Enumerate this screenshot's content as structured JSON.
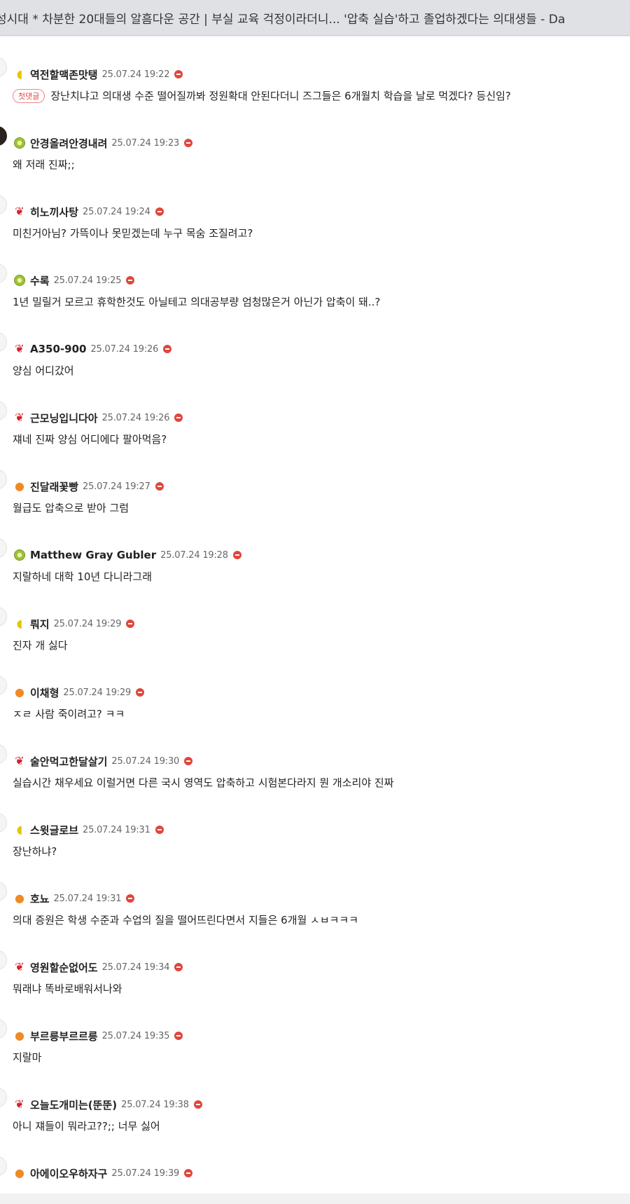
{
  "window": {
    "title": "성시대 *  차분한 20대들의 알흠다운 공간 | 부실 교육 걱정이라더니... '압축 실습'하고 졸업하겠다는 의대생들 - Da"
  },
  "colors": {
    "report": "#e0463c",
    "first_comment_badge": "#e04545",
    "page_background": "#ffffff"
  },
  "comments": [
    {
      "level_icon": "lemon-icon",
      "nickname": "역전할맥존맛탱",
      "timestamp": "25.07.24 19:22",
      "first_badge": "첫댓글",
      "text": "장난치냐고 의대생 수준 떨어질까봐 정원확대 안된다더니 즈그들은 6개월치 학습을 날로 먹겠다? 등신임?"
    },
    {
      "level_icon": "kiwi-icon",
      "nickname": "안경올려안경내려",
      "timestamp": "25.07.24 19:23",
      "text": "왜 저래 진짜;;"
    },
    {
      "level_icon": "cherry-icon",
      "nickname": "히노끼사탕",
      "timestamp": "25.07.24 19:24",
      "text": "미친거아님? 가뜩이나 못믿겠는데 누구 목숨 조질려고?"
    },
    {
      "level_icon": "kiwi-icon",
      "nickname": "수록",
      "timestamp": "25.07.24 19:25",
      "text": "1년 밀릴거 모르고 휴학한것도 아닐테고 의대공부량 엄청많은거 아닌가 압축이 돼..?"
    },
    {
      "level_icon": "cherry-icon",
      "nickname": "A350-900",
      "timestamp": "25.07.24 19:26",
      "text": "양심 어디갔어"
    },
    {
      "level_icon": "cherry-icon",
      "nickname": "근모닝입니다아",
      "timestamp": "25.07.24 19:26",
      "text": "쟤네 진짜 양심 어디에다 팔아먹음?"
    },
    {
      "level_icon": "orange-icon",
      "nickname": "진달래꽃빵",
      "timestamp": "25.07.24 19:27",
      "text": "월급도 압축으로 받아 그럼"
    },
    {
      "level_icon": "kiwi-icon",
      "nickname": "Matthew Gray Gubler",
      "timestamp": "25.07.24 19:28",
      "text": "지랄하네 대학 10년 다니라그래"
    },
    {
      "level_icon": "lemon-icon",
      "nickname": "뤄지",
      "timestamp": "25.07.24 19:29",
      "text": "진자 개 싫다"
    },
    {
      "level_icon": "orange-icon",
      "nickname": "이채형",
      "timestamp": "25.07.24 19:29",
      "text": "ㅈㄹ 사람 죽이려고? ㅋㅋ"
    },
    {
      "level_icon": "cherry-icon",
      "nickname": "술안먹고한달살기",
      "timestamp": "25.07.24 19:30",
      "text": "실습시간 채우세요 이럴거면 다른 국시 영역도 압축하고 시험본다라지 뭔 개소리야 진짜"
    },
    {
      "level_icon": "lemon-icon",
      "nickname": "스윗글로브",
      "timestamp": "25.07.24 19:31",
      "text": "장난하냐?"
    },
    {
      "level_icon": "orange-icon",
      "nickname": "호뇨",
      "timestamp": "25.07.24 19:31",
      "text": "의대 증원은 학생 수준과 수업의 질을 떨어뜨린다면서 지들은 6개월 ㅅㅂㅋㅋㅋ"
    },
    {
      "level_icon": "cherry-icon",
      "nickname": "영원할순없어도",
      "timestamp": "25.07.24 19:34",
      "text": "뭐래냐 똑바로배워서나와"
    },
    {
      "level_icon": "orange-icon",
      "nickname": "부르릉부르르릉",
      "timestamp": "25.07.24 19:35",
      "text": "지랄마"
    },
    {
      "level_icon": "cherry-icon",
      "nickname": "오늘도개미는(뚠뚠)",
      "timestamp": "25.07.24 19:38",
      "text": "아니 쟤들이 뭐라고??;; 너무 싫어"
    },
    {
      "level_icon": "orange-icon",
      "nickname": "아에이오우하자구",
      "timestamp": "25.07.24 19:39",
      "text": ""
    }
  ]
}
